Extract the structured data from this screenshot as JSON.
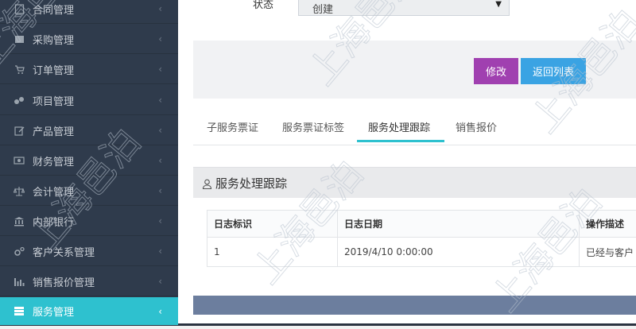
{
  "sidebar": {
    "items": [
      {
        "label": "合同管理",
        "icon": "contract-icon"
      },
      {
        "label": "采购管理",
        "icon": "purchase-icon"
      },
      {
        "label": "订单管理",
        "icon": "cart-icon"
      },
      {
        "label": "项目管理",
        "icon": "project-icon"
      },
      {
        "label": "产品管理",
        "icon": "edit-icon"
      },
      {
        "label": "财务管理",
        "icon": "money-icon"
      },
      {
        "label": "会计管理",
        "icon": "scale-icon"
      },
      {
        "label": "内部银行",
        "icon": "bank-icon"
      },
      {
        "label": "客户关系管理",
        "icon": "gears-icon"
      },
      {
        "label": "销售报价管理",
        "icon": "bar-chart-icon"
      },
      {
        "label": "服务管理",
        "icon": "server-icon",
        "active": true
      }
    ]
  },
  "form": {
    "status_label": "状态",
    "status_value": "创建"
  },
  "actions": {
    "edit_label": "修改",
    "back_label": "返回列表"
  },
  "tabs": [
    {
      "label": "子服务票证"
    },
    {
      "label": "服务票证标签"
    },
    {
      "label": "服务处理跟踪",
      "active": true
    },
    {
      "label": "销售报价"
    }
  ],
  "panel": {
    "title": "服务处理跟踪"
  },
  "log_table": {
    "columns": [
      "日志标识",
      "日志日期",
      "操作描述"
    ],
    "rows": [
      [
        "1",
        "2019/4/10 0:00:00",
        "已经与客户"
      ]
    ]
  },
  "watermark": {
    "text": "上海邑泊"
  },
  "colors": {
    "sidebar_bg": "#2f3b4c",
    "active_accent": "#2ec1cf",
    "edit_button": "#a040b0",
    "back_button": "#3aa3e3",
    "footer_bar": "#6c7e9e"
  }
}
